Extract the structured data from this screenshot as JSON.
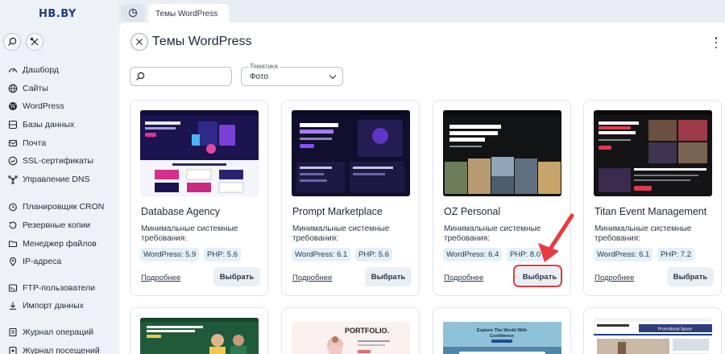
{
  "brand": {
    "logo": "HB.BY"
  },
  "sidebar": {
    "items": [
      {
        "label": "Дашборд",
        "icon": "dashboard-icon"
      },
      {
        "label": "Сайты",
        "icon": "globe-icon"
      },
      {
        "label": "WordPress",
        "icon": "wordpress-icon"
      },
      {
        "label": "Базы данных",
        "icon": "database-icon"
      },
      {
        "label": "Почта",
        "icon": "mail-icon"
      },
      {
        "label": "SSL-сертификаты",
        "icon": "ssl-icon"
      },
      {
        "label": "Управление DNS",
        "icon": "dns-icon"
      },
      {
        "label": "Планировщик CRON",
        "icon": "cron-icon"
      },
      {
        "label": "Резервные копии",
        "icon": "backup-icon"
      },
      {
        "label": "Менеджер файлов",
        "icon": "folder-icon"
      },
      {
        "label": "IP-адреса",
        "icon": "location-icon"
      },
      {
        "label": "FTP-пользователи",
        "icon": "ftp-icon"
      },
      {
        "label": "Импорт данных",
        "icon": "import-icon"
      },
      {
        "label": "Журнал операций",
        "icon": "log-icon"
      },
      {
        "label": "Журнал посещений",
        "icon": "visits-icon"
      }
    ]
  },
  "tabs": {
    "active": "Темы WordPress"
  },
  "page": {
    "title": "Темы WordPress"
  },
  "filters": {
    "search_placeholder": "",
    "category_label": "Тематика",
    "category_value": "Фото"
  },
  "themes": [
    {
      "name": "Database Agency",
      "req": "Минимальные системные требования:",
      "wp": "WordPress: 5.9",
      "php": "PHP: 5.6",
      "more": "Подробнее",
      "pick": "Выбрать"
    },
    {
      "name": "Prompt Marketplace",
      "req": "Минимальные системные требования:",
      "wp": "WordPress: 6.1",
      "php": "PHP: 5.6",
      "more": "Подробнее",
      "pick": "Выбрать"
    },
    {
      "name": "OZ Personal",
      "req": "Минимальные системные требования:",
      "wp": "WordPress: 6.4",
      "php": "PHP: 8.0",
      "more": "Подробнее",
      "pick": "Выбрать"
    },
    {
      "name": "Titan Event Management",
      "req": "Минимальные системные требования:",
      "wp": "WordPress: 6.1",
      "php": "PHP: 7.2",
      "more": "Подробнее",
      "pick": "Выбрать"
    }
  ],
  "thumbs": {
    "t1": {
      "headline": "Secure, Reliable & High-Speed Database Infrastructure"
    },
    "t2": {
      "headline": "Buy & Sell High-Converting AI Prompts"
    },
    "t3": {
      "headline": "I design and build calm software — and write about the craft behind it"
    },
    "t4": {
      "headline": "Creating Unforgettable Events That Inspire & Elevate Every Celebration"
    },
    "b2": {
      "headline": "PORTFOLIO."
    },
    "b3": {
      "headline": "Explore The World With Confidence"
    },
    "b4": {
      "headline": "Promotional Space"
    }
  },
  "colors": {
    "accent": "#e8393f",
    "chip": "#e3f1f9",
    "button": "#eaeff6"
  }
}
